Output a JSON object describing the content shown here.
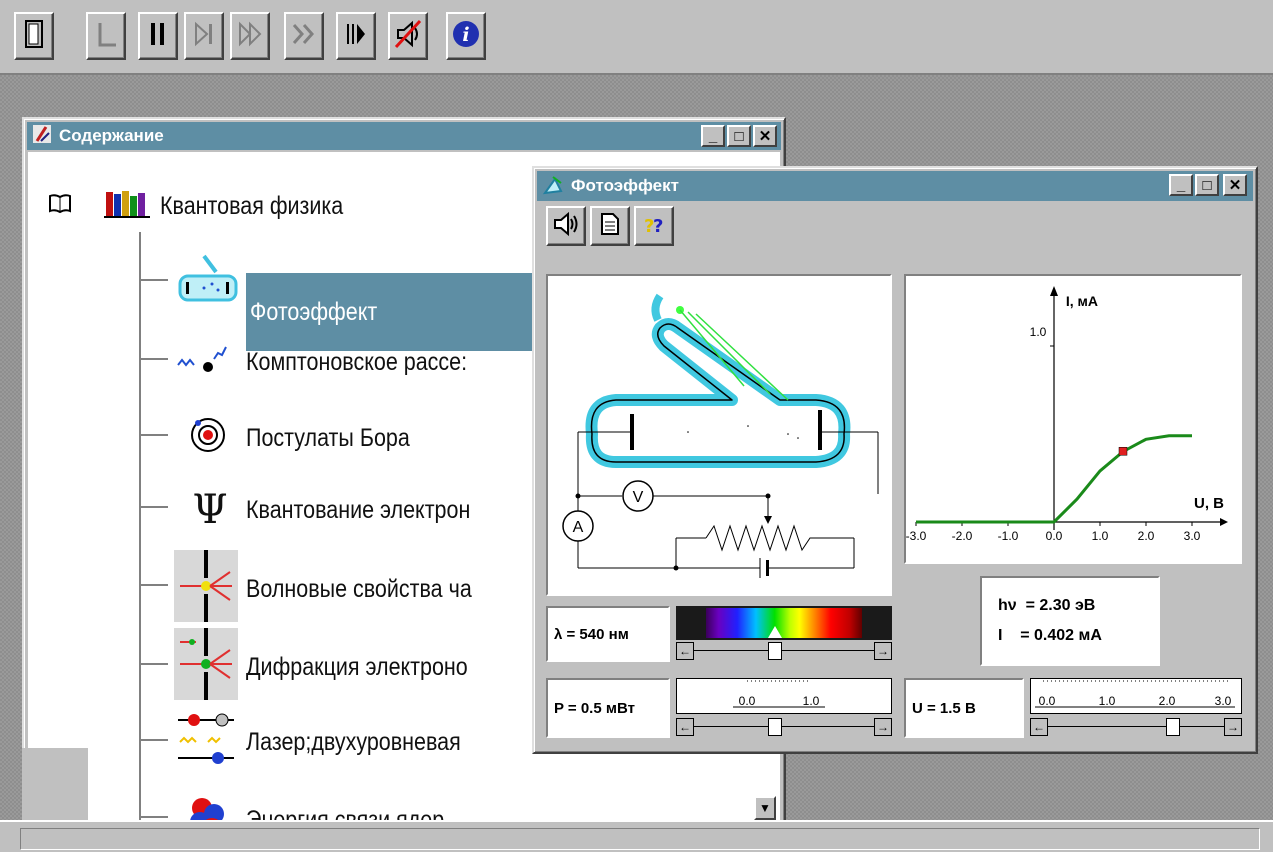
{
  "contents_window": {
    "title": "Содержание",
    "root_label": "Квантовая физика",
    "items": [
      {
        "label": "Фотоэффект",
        "icon": "photoeffect-icon"
      },
      {
        "label": "Комптоновское рассе:",
        "icon": "compton-icon"
      },
      {
        "label": "Постулаты Бора",
        "icon": "bohr-atom-icon"
      },
      {
        "label": "Квантование электрон",
        "icon": "psi-icon"
      },
      {
        "label": "Волновые свойства ча",
        "icon": "wave-properties-icon"
      },
      {
        "label": "Дифракция электроно",
        "icon": "diffraction-icon"
      },
      {
        "label": "Лазер;двухуровневая",
        "icon": "laser-icon"
      },
      {
        "label": "Энергия связи ядер",
        "icon": "nucleus-icon"
      }
    ]
  },
  "photo_window": {
    "title": "Фотоэффект",
    "wavelength_label": "λ = 540 нм",
    "power_label": "P = 0.5 мВт",
    "voltage_label": "U = 1.5 B",
    "energy_label": "hν  = 2.30 эВ",
    "current_label": "I    = 0.402 мА",
    "graph": {
      "y_axis_label": "I, мА",
      "x_axis_label": "U, B",
      "y_tick": "1.0",
      "x_ticks": [
        "-3.0",
        "-2.0",
        "-1.0",
        "0.0",
        "1.0",
        "2.0",
        "3.0"
      ]
    },
    "circuit": {
      "voltmeter_label": "V",
      "ammeter_label": "A"
    },
    "power_scale": [
      "0.0",
      "1.0"
    ],
    "voltage_scale": [
      "0.0",
      "1.0",
      "2.0",
      "3.0"
    ]
  },
  "chart_data": {
    "type": "line",
    "title": "",
    "xlabel": "U, B",
    "ylabel": "I, мА",
    "xlim": [
      -3.0,
      3.0
    ],
    "ylim": [
      0,
      1.0
    ],
    "series": [
      {
        "x": [
          -3.0,
          -2.0,
          -1.0,
          0.0,
          0.5,
          1.0,
          1.5,
          2.0,
          2.5,
          3.0
        ],
        "y": [
          0.0,
          0.0,
          0.0,
          0.0,
          0.13,
          0.29,
          0.4,
          0.47,
          0.49,
          0.49
        ]
      }
    ],
    "marker": {
      "x": 1.5,
      "y": 0.402
    }
  }
}
